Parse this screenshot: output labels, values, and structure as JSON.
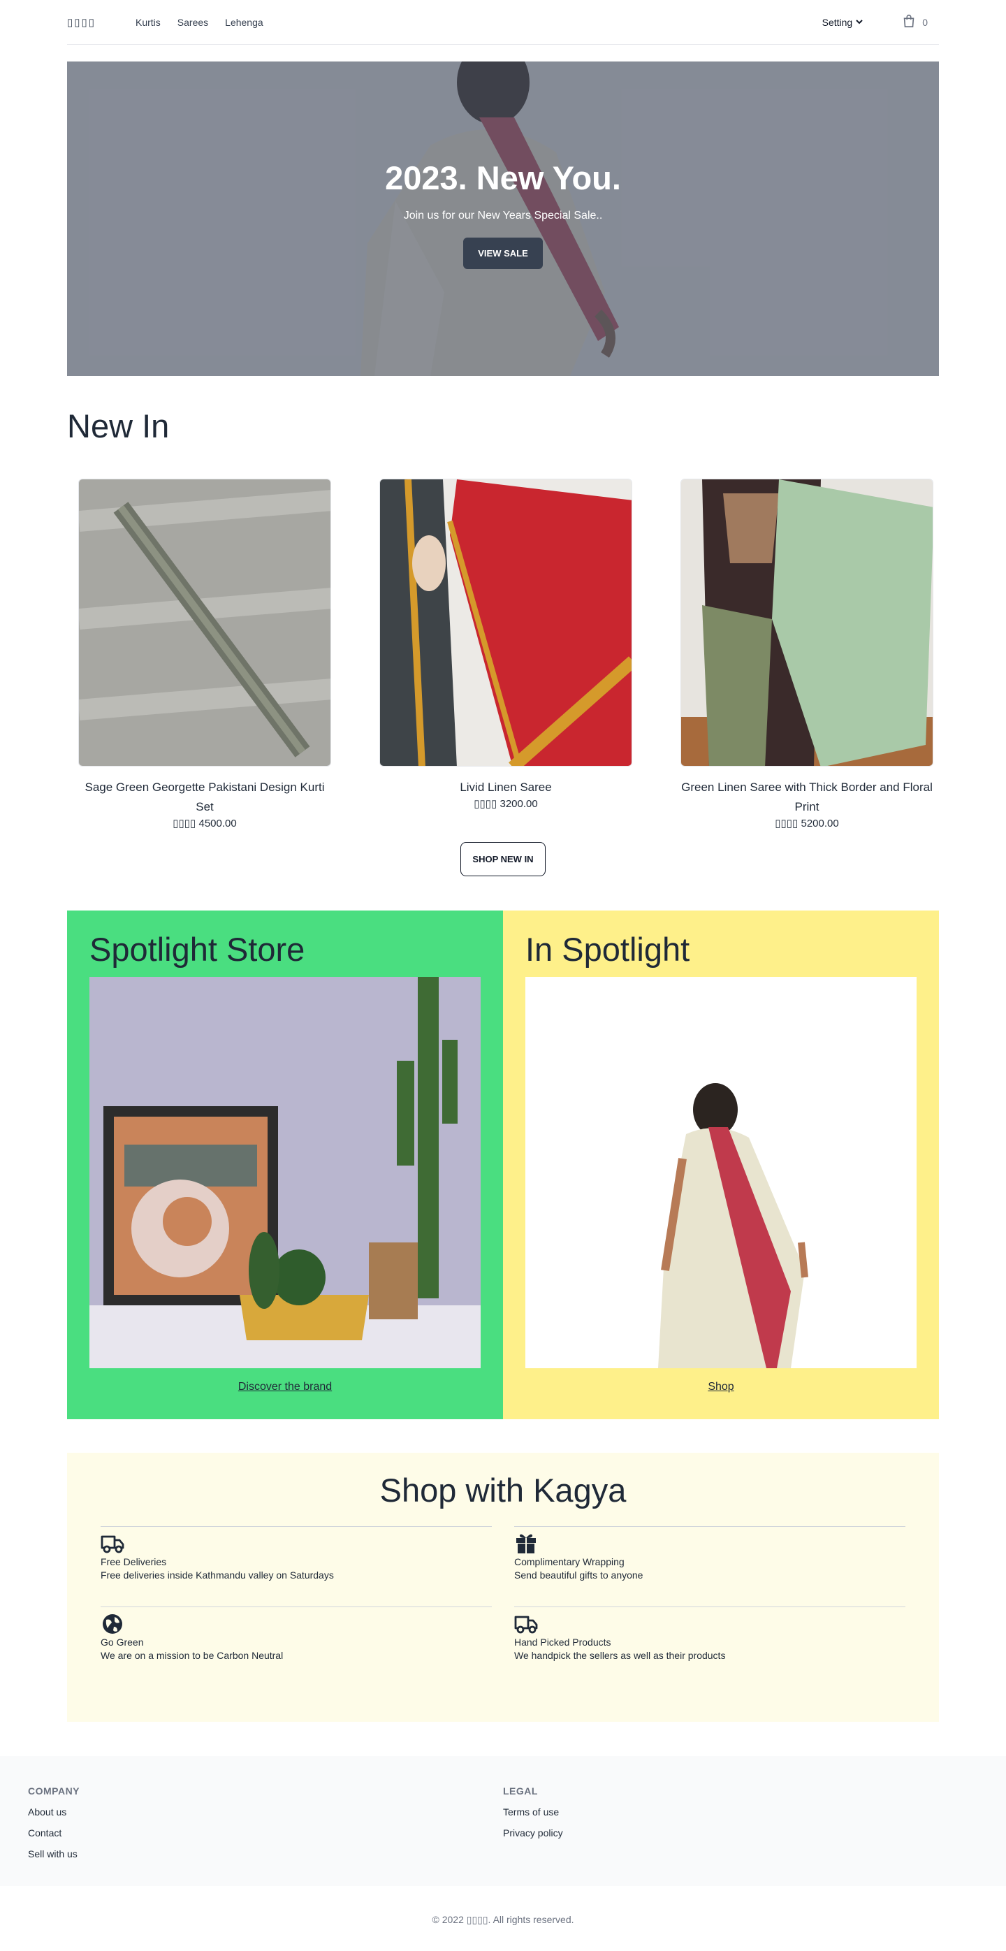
{
  "nav": {
    "logo": "▯▯▯▯",
    "links": [
      "Kurtis",
      "Sarees",
      "Lehenga"
    ],
    "setting_label": "Setting",
    "cart_count": "0"
  },
  "hero": {
    "title": "2023. New You.",
    "subtitle": "Join us for our New Years Special Sale..",
    "button": "VIEW SALE"
  },
  "new_in": {
    "title": "New In",
    "products": [
      {
        "name": "Sage Green Georgette Pakistani Design Kurti Set",
        "price": "▯▯▯▯ 4500.00"
      },
      {
        "name": "Livid Linen Saree",
        "price": "▯▯▯▯ 3200.00"
      },
      {
        "name": "Green Linen Saree with Thick Border and Floral Print",
        "price": "▯▯▯▯ 5200.00"
      }
    ],
    "button": "SHOP NEW IN"
  },
  "spotlight": {
    "left": {
      "title": "Spotlight Store",
      "link": "Discover the brand"
    },
    "right": {
      "title": "In Spotlight",
      "link": "Shop"
    }
  },
  "shop_with": {
    "title": "Shop with Kagya",
    "features": [
      {
        "icon": "truck-icon",
        "name": "Free Deliveries",
        "desc": "Free deliveries inside Kathmandu valley on Saturdays"
      },
      {
        "icon": "gift-icon",
        "name": "Complimentary Wrapping",
        "desc": "Send beautiful gifts to anyone"
      },
      {
        "icon": "globe-icon",
        "name": "Go Green",
        "desc": "We are on a mission to be Carbon Neutral"
      },
      {
        "icon": "truck-icon",
        "name": "Hand Picked Products",
        "desc": "We handpick the sellers as well as their products"
      }
    ]
  },
  "footer": {
    "company": {
      "heading": "COMPANY",
      "links": [
        "About us",
        "Contact",
        "Sell with us"
      ]
    },
    "legal": {
      "heading": "LEGAL",
      "links": [
        "Terms of use",
        "Privacy policy"
      ]
    },
    "copyright": "© 2022 ▯▯▯▯. All rights reserved."
  }
}
